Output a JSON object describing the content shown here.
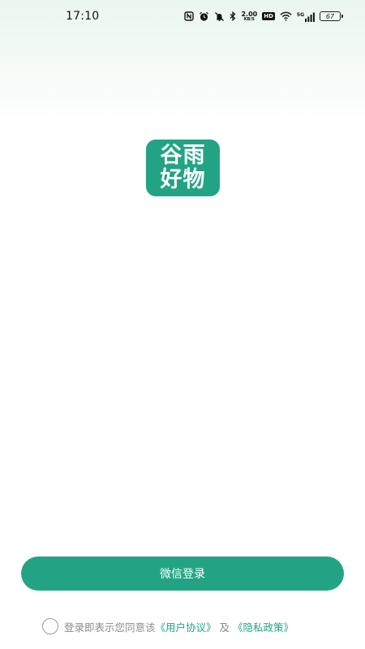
{
  "status_bar": {
    "time": "17:10",
    "net_speed_value": "2.00",
    "net_speed_unit": "KB/S",
    "hd_label": "HD",
    "network_type": "5G",
    "battery_level": "67",
    "icons": [
      "nfc-icon",
      "alarm-icon",
      "mute-icon",
      "bluetooth-icon",
      "wifi-icon",
      "signal-icon",
      "battery-icon"
    ]
  },
  "logo": {
    "line1": "谷雨",
    "line2": "好物",
    "color": "#22a484"
  },
  "login": {
    "button_label": "微信登录",
    "button_color": "#22a484"
  },
  "agreement": {
    "prefix": "登录即表示您同意该",
    "user_agreement": "《用户协议》",
    "conjunction": "及",
    "privacy_policy": "《隐私政策》",
    "link_color": "#22a484",
    "checked": false
  }
}
